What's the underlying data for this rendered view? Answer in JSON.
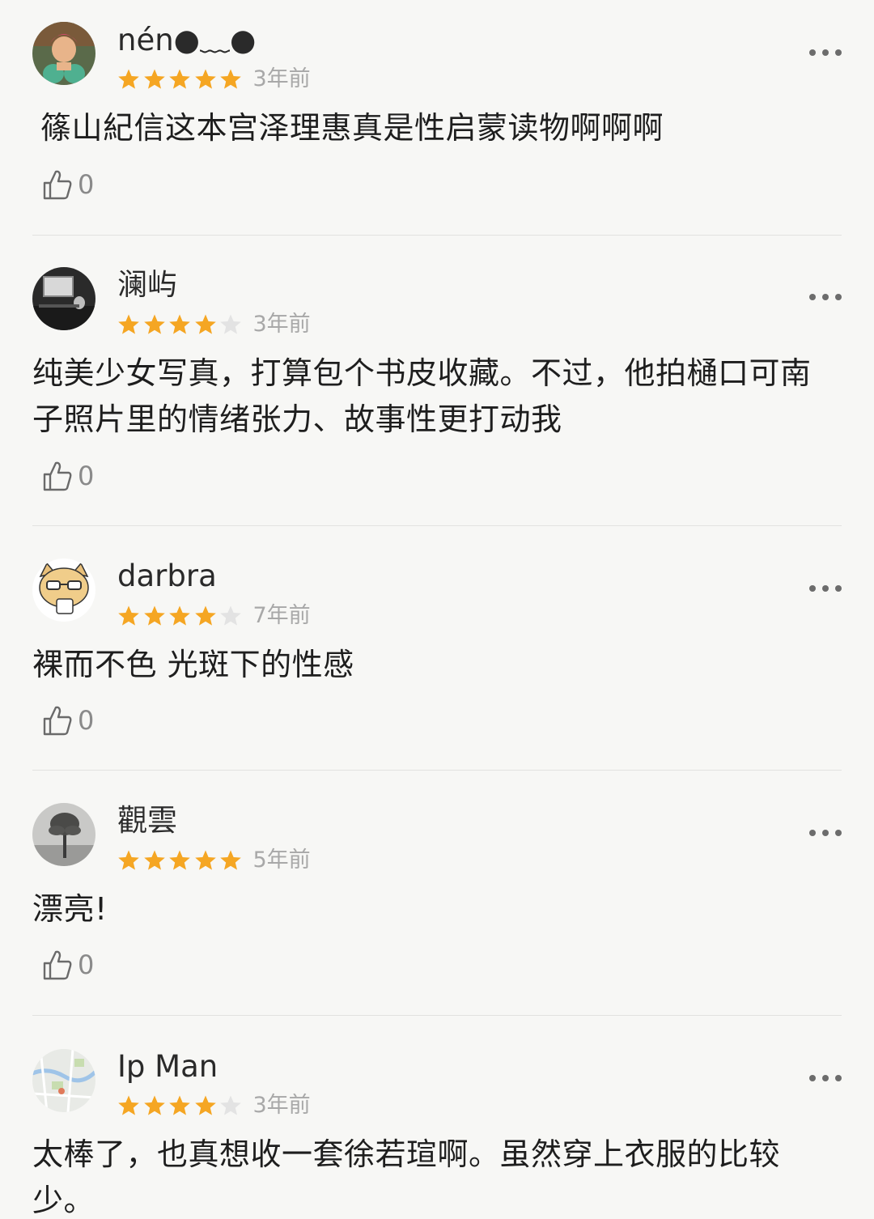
{
  "reviews": [
    {
      "username": "nén●﹏●",
      "stars_filled": 5,
      "stars_total": 5,
      "time": "3年前",
      "content": "篠山紀信这本宫泽理惠真是性启蒙读物啊啊啊",
      "likes": "0",
      "avatar_icon": "anime-character-avatar"
    },
    {
      "username": "澜屿",
      "stars_filled": 4,
      "stars_total": 5,
      "time": "3年前",
      "content": "纯美少女写真，打算包个书皮收藏。不过，他拍樋口可南子照片里的情绪张力、故事性更打动我",
      "likes": "0",
      "avatar_icon": "dark-room-photo-avatar"
    },
    {
      "username": "darbra",
      "stars_filled": 4,
      "stars_total": 5,
      "time": "7年前",
      "content": "裸而不色 光斑下的性感",
      "likes": "0",
      "avatar_icon": "cartoon-cat-avatar"
    },
    {
      "username": "觀雲",
      "stars_filled": 5,
      "stars_total": 5,
      "time": "5年前",
      "content": "漂亮!",
      "likes": "0",
      "avatar_icon": "tree-photo-avatar"
    },
    {
      "username": "Ip Man",
      "stars_filled": 4,
      "stars_total": 5,
      "time": "3年前",
      "content": "太棒了，也真想收一套徐若瑄啊。虽然穿上衣服的比较少。",
      "likes": "0",
      "avatar_icon": "map-avatar"
    }
  ],
  "colors": {
    "star_filled": "#f5a623",
    "star_empty": "#e3e3e3",
    "background": "#f7f7f5",
    "meta_text": "#a8a8a8"
  }
}
